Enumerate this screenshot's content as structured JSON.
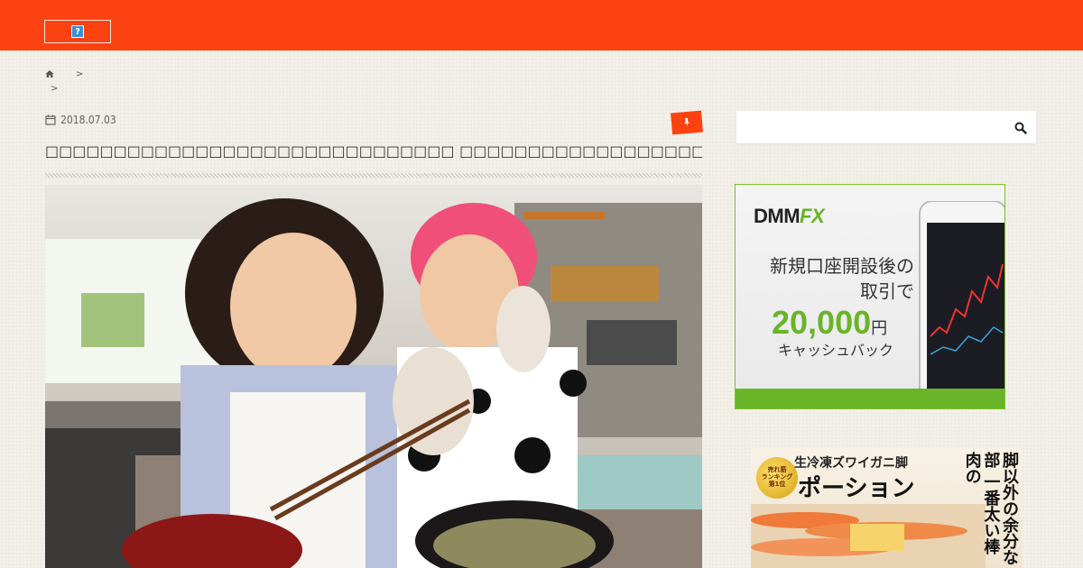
{
  "header": {
    "logo_glyph": "?"
  },
  "breadcrumb": {
    "sep1": ">",
    "sep2": ">"
  },
  "post": {
    "date": "2018.07.03",
    "title": "□□□□□□□□□□□□□□□□□□□□□□□□□□□□□□ □□□□□□□□□□□□□□□□□□□□□□□□□□□□□□□□□□□□□□□□□□□□□□"
  },
  "sidebar": {
    "search_placeholder": "",
    "ad1": {
      "logo_dmm": "DMM",
      "logo_fx": "FX",
      "line1": "新規口座開設後の",
      "line2": "取引で",
      "amount": "20,000",
      "yen": "円",
      "cashback": "キャッシュバック"
    },
    "ad2": {
      "head": "生冷凍ズワイガニ脚",
      "title": "ポーション",
      "badge_l1": "売れ筋",
      "badge_l2": "ランキング",
      "badge_l3": "第1位",
      "vertical": "脚以外の余分な部 一番太い棒肉の"
    }
  },
  "colors": {
    "accent": "#fc4210",
    "background": "#f2efe8",
    "dmm_green": "#6ab42a"
  },
  "icons": {
    "home": "home-icon",
    "calendar": "calendar-icon",
    "category": "pin-icon",
    "search": "search-icon"
  }
}
